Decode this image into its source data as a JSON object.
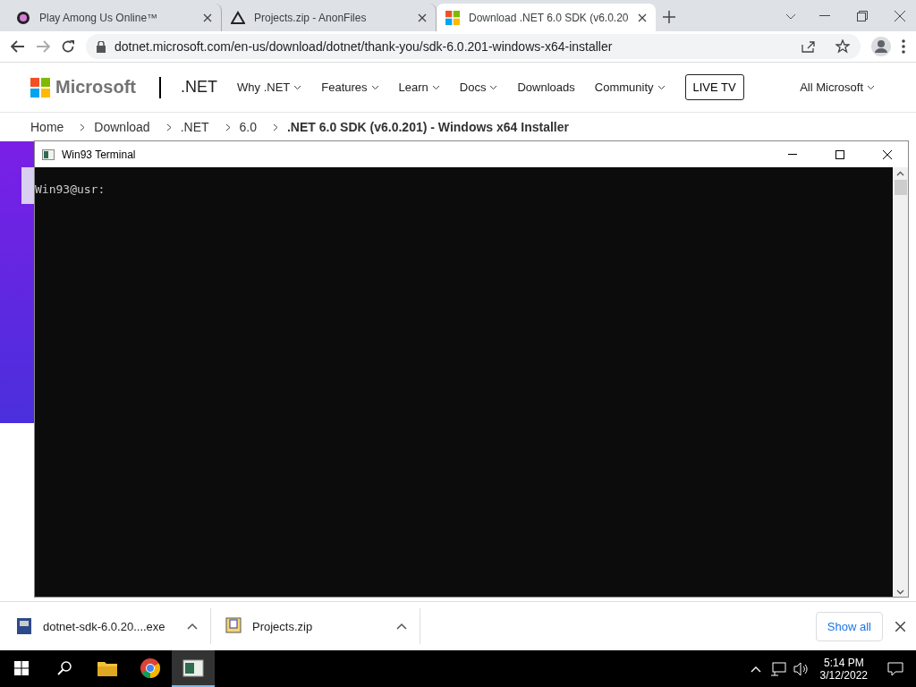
{
  "browser": {
    "tabs": [
      {
        "title": "Play Among Us Online™",
        "kind": "game",
        "selected": false
      },
      {
        "title": "Projects.zip - AnonFiles",
        "kind": "files",
        "selected": false
      },
      {
        "title": "Download .NET 6.0 SDK (v6.0.20",
        "kind": "microsoft",
        "selected": true
      }
    ],
    "address": "dotnet.microsoft.com/en-us/download/dotnet/thank-you/sdk-6.0.201-windows-x64-installer"
  },
  "site_header": {
    "brand": "Microsoft",
    "product": ".NET",
    "nav": [
      {
        "label": "Why .NET",
        "kind": "dropdown"
      },
      {
        "label": "Features",
        "kind": "dropdown"
      },
      {
        "label": "Learn",
        "kind": "dropdown"
      },
      {
        "label": "Docs",
        "kind": "dropdown"
      },
      {
        "label": "Downloads",
        "kind": "link"
      },
      {
        "label": "Community",
        "kind": "dropdown"
      },
      {
        "label": "LIVE TV",
        "kind": "button"
      }
    ],
    "all_microsoft": "All Microsoft"
  },
  "breadcrumb": [
    {
      "label": "Home",
      "current": false
    },
    {
      "label": "Download",
      "current": false
    },
    {
      "label": ".NET",
      "current": false
    },
    {
      "label": "6.0",
      "current": false
    },
    {
      "label": ".NET 6.0 SDK (v6.0.201) - Windows x64 Installer",
      "current": true
    }
  ],
  "terminal": {
    "title": "Win93 Terminal",
    "prompt": "Win93@usr:"
  },
  "downloads": {
    "items": [
      {
        "name": "dotnet-sdk-6.0.20....exe",
        "kind": "installer"
      },
      {
        "name": "Projects.zip",
        "kind": "archive"
      }
    ],
    "show_all": "Show all"
  },
  "taskbar": {
    "apps": [
      {
        "kind": "explorer",
        "selected": false
      },
      {
        "kind": "chrome",
        "selected": false
      },
      {
        "kind": "terminal",
        "selected": true
      }
    ],
    "time": "5:14 PM",
    "date": "3/12/2022"
  }
}
